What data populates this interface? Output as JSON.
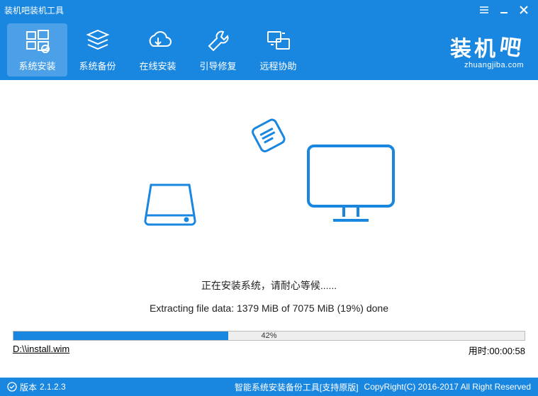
{
  "window": {
    "title": "装机吧装机工具"
  },
  "nav": {
    "items": [
      {
        "label": "系统安装"
      },
      {
        "label": "系统备份"
      },
      {
        "label": "在线安装"
      },
      {
        "label": "引导修复"
      },
      {
        "label": "远程协助"
      }
    ]
  },
  "brand": {
    "main": "装机",
    "ba": "吧",
    "sub": "zhuangjiba.com"
  },
  "status": {
    "installing": "正在安装系统，请耐心等候......",
    "extracting": "Extracting file data: 1379 MiB of 7075 MiB (19%) done"
  },
  "progress": {
    "percent": 42,
    "percent_label": "42%"
  },
  "file": {
    "path": "D:\\\\install.wim"
  },
  "timer": {
    "label": "用时:",
    "value": "00:00:58"
  },
  "footer": {
    "version_label": "版本",
    "version": "2.1.2.3",
    "desc": "智能系统安装备份工具[支持原版]",
    "copyright": "CopyRight(C) 2016-2017 All Right Reserved"
  }
}
